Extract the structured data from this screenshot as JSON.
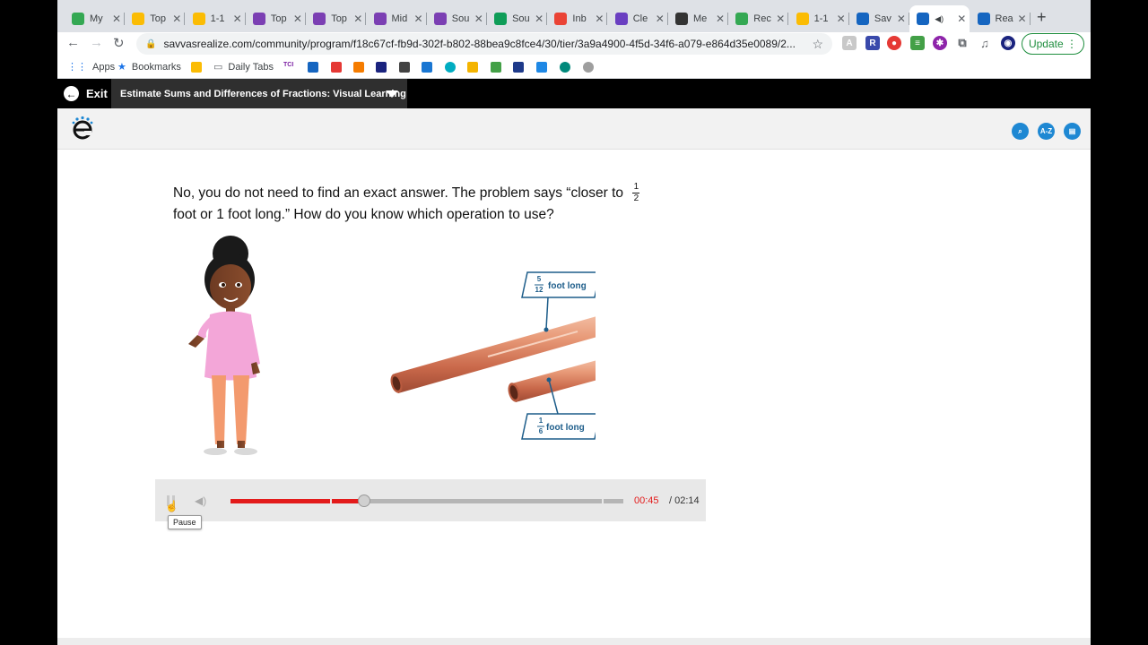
{
  "browser": {
    "tabs": [
      {
        "title": "My",
        "color": "#34a853",
        "icon": "drive-icon"
      },
      {
        "title": "Top",
        "color": "#fbbc04",
        "icon": "slides-icon"
      },
      {
        "title": "1-1",
        "color": "#fbbc04",
        "icon": "slides-icon"
      },
      {
        "title": "Top",
        "color": "#7b3fb3",
        "icon": "forms-icon"
      },
      {
        "title": "Top",
        "color": "#7b3fb3",
        "icon": "forms-icon"
      },
      {
        "title": "Mid",
        "color": "#7b3fb3",
        "icon": "forms-icon"
      },
      {
        "title": "Sou",
        "color": "#7b3fb3",
        "icon": "forms-icon"
      },
      {
        "title": "Sou",
        "color": "#0f9d58",
        "icon": "sheets-icon"
      },
      {
        "title": "Inb",
        "color": "#ea4335",
        "icon": "gmail-icon"
      },
      {
        "title": "Cle",
        "color": "#6a3fc1",
        "icon": "clever-icon"
      },
      {
        "title": "Me",
        "color": "#333333",
        "icon": "s-icon"
      },
      {
        "title": "Rec",
        "color": "#34a853",
        "icon": "drive-icon"
      },
      {
        "title": "1-1",
        "color": "#fbbc04",
        "icon": "slides-icon"
      },
      {
        "title": "Sav",
        "color": "#1565c0",
        "icon": "savvas-icon"
      },
      {
        "title": "",
        "color": "#1565c0",
        "icon": "savvas-icon",
        "active": true
      },
      {
        "title": "Rea",
        "color": "#1565c0",
        "icon": "savvas-icon"
      }
    ],
    "url": "savvasrealize.com/community/program/f18c67cf-fb9d-302f-b802-88bea9c8fce4/30/tier/3a9a4900-4f5d-34f6-a079-e864d35e0089/2...",
    "update_label": "Update",
    "bookmarks": [
      "Apps",
      "Bookmarks",
      "Daily Tabs"
    ]
  },
  "app": {
    "exit_label": "Exit",
    "lesson_title": "Estimate Sums and Differences of Fractions: Visual Learning",
    "tools": [
      "zoom-icon",
      "A-Z",
      "print-icon"
    ]
  },
  "question": {
    "text1": "No, you do not need to find an exact answer. The problem says “closer to",
    "frac_num": "1",
    "frac_den": "2",
    "text2": "foot or 1 foot long.” How do you know which operation to use?"
  },
  "figure": {
    "label_long_num": "5",
    "label_long_den": "12",
    "label_long_text": "foot long",
    "label_short_num": "1",
    "label_short_den": "6",
    "label_short_text": "foot long"
  },
  "player": {
    "current_time": "00:45",
    "total_time": "/ 02:14",
    "progress": 0.34,
    "tooltip": "Pause"
  }
}
